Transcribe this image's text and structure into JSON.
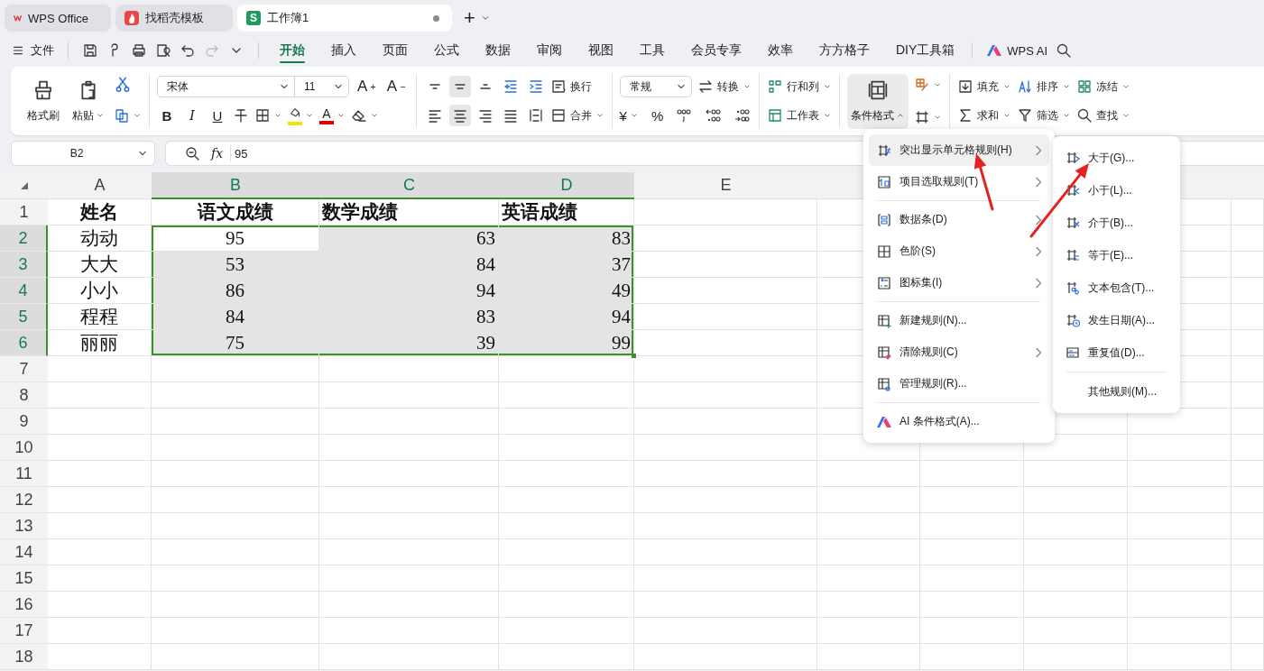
{
  "tabs": [
    {
      "label": "WPS Office",
      "kind": "wps",
      "selected": false,
      "modified": false
    },
    {
      "label": "找稻壳模板",
      "kind": "docer",
      "selected": false,
      "modified": false
    },
    {
      "label": "工作簿1",
      "kind": "sheet",
      "logo": "S",
      "selected": true,
      "modified": true
    }
  ],
  "new_tab": "+",
  "file_menu": "文件",
  "ribbon_tabs": [
    {
      "label": "开始",
      "selected": true
    },
    {
      "label": "插入",
      "selected": false
    },
    {
      "label": "页面",
      "selected": false
    },
    {
      "label": "公式",
      "selected": false
    },
    {
      "label": "数据",
      "selected": false
    },
    {
      "label": "审阅",
      "selected": false
    },
    {
      "label": "视图",
      "selected": false
    },
    {
      "label": "工具",
      "selected": false
    },
    {
      "label": "会员专享",
      "selected": false
    },
    {
      "label": "效率",
      "selected": false
    },
    {
      "label": "方方格子",
      "selected": false
    },
    {
      "label": "DIY工具箱",
      "selected": false
    }
  ],
  "ai_label": "WPS AI",
  "ribbon": {
    "format_painter": "格式刷",
    "paste": "粘贴",
    "font": "宋体",
    "font_size": "11",
    "size_buttons": [
      {
        "letter": "A",
        "sign": "+"
      },
      {
        "letter": "A",
        "sign": "−"
      }
    ],
    "style_buttons": [
      "B",
      "I",
      "U"
    ],
    "font_color_letter": "A",
    "align_buttons": [
      {
        "kind": "top",
        "selected": false
      },
      {
        "kind": "middle",
        "selected": true
      },
      {
        "kind": "bottom",
        "selected": false
      },
      {
        "kind": "outdent",
        "selected": false
      },
      {
        "kind": "indent",
        "selected": false
      },
      {
        "kind": "left",
        "selected": false
      },
      {
        "kind": "center",
        "selected": true
      },
      {
        "kind": "right",
        "selected": false
      },
      {
        "kind": "justify",
        "selected": false
      },
      {
        "kind": "distributed",
        "selected": false
      }
    ],
    "wrap": "换行",
    "merge": "合并",
    "number_format": "常规",
    "convert": "转换",
    "currency": "¥",
    "percent": "%",
    "rows_cols": "行和列",
    "worksheet": "工作表",
    "conditional_format": {
      "label": "条件格式",
      "expanded": true
    },
    "fill": "填充",
    "sort": "排序",
    "freeze": "冻结",
    "sum": "求和",
    "filter": "筛选",
    "find": "查找"
  },
  "name_box": "B2",
  "fx": "fx",
  "formula": "95",
  "columns": [
    {
      "label": "A",
      "selected": false
    },
    {
      "label": "B",
      "selected": true
    },
    {
      "label": "C",
      "selected": true
    },
    {
      "label": "D",
      "selected": true
    },
    {
      "label": "E",
      "selected": false
    }
  ],
  "rows": [
    {
      "label": "1",
      "selected": false,
      "cells": [
        {
          "text": "姓名",
          "selected": false
        },
        {
          "text": "语文成绩",
          "selected": false
        },
        {
          "text": "数学成绩",
          "selected": false
        },
        {
          "text": "英语成绩",
          "selected": false
        }
      ]
    },
    {
      "label": "2",
      "selected": true,
      "cells": [
        {
          "text": "动动",
          "selected": false
        },
        {
          "text": "95",
          "selected": true
        },
        {
          "text": "63",
          "selected": true
        },
        {
          "text": "83",
          "selected": true
        }
      ]
    },
    {
      "label": "3",
      "selected": true,
      "cells": [
        {
          "text": "大大",
          "selected": false
        },
        {
          "text": "53",
          "selected": true
        },
        {
          "text": "84",
          "selected": true
        },
        {
          "text": "37",
          "selected": true
        }
      ]
    },
    {
      "label": "4",
      "selected": true,
      "cells": [
        {
          "text": "小小",
          "selected": false
        },
        {
          "text": "86",
          "selected": true
        },
        {
          "text": "94",
          "selected": true
        },
        {
          "text": "49",
          "selected": true
        }
      ]
    },
    {
      "label": "5",
      "selected": true,
      "cells": [
        {
          "text": "程程",
          "selected": false
        },
        {
          "text": "84",
          "selected": true
        },
        {
          "text": "83",
          "selected": true
        },
        {
          "text": "94",
          "selected": true
        }
      ]
    },
    {
      "label": "6",
      "selected": true,
      "cells": [
        {
          "text": "丽丽",
          "selected": false
        },
        {
          "text": "75",
          "selected": true
        },
        {
          "text": "39",
          "selected": true
        },
        {
          "text": "99",
          "selected": true
        }
      ]
    },
    {
      "label": "7",
      "selected": false
    },
    {
      "label": "8",
      "selected": false
    },
    {
      "label": "9",
      "selected": false
    },
    {
      "label": "10",
      "selected": false
    },
    {
      "label": "11",
      "selected": false
    },
    {
      "label": "12",
      "selected": false
    },
    {
      "label": "13",
      "selected": false
    },
    {
      "label": "14",
      "selected": false
    },
    {
      "label": "15",
      "selected": false
    },
    {
      "label": "16",
      "selected": false
    },
    {
      "label": "17",
      "selected": false
    },
    {
      "label": "18",
      "selected": false
    }
  ],
  "menu": {
    "sections": [
      {
        "items": [
          {
            "label": "突出显示单元格规则(H)",
            "kind": "highlight",
            "submenu": true,
            "selected": true
          },
          {
            "label": "项目选取规则(T)",
            "kind": "top10",
            "submenu": true,
            "selected": false
          }
        ]
      },
      {
        "items": [
          {
            "label": "数据条(D)",
            "kind": "databar",
            "submenu": true,
            "selected": false
          },
          {
            "label": "色阶(S)",
            "kind": "colorscale",
            "submenu": true,
            "selected": false
          },
          {
            "label": "图标集(I)",
            "kind": "iconset",
            "submenu": true,
            "selected": false
          }
        ]
      },
      {
        "items": [
          {
            "label": "新建规则(N)...",
            "kind": "new",
            "submenu": false,
            "selected": false
          },
          {
            "label": "清除规则(C)",
            "kind": "clear",
            "submenu": true,
            "selected": false
          },
          {
            "label": "管理规则(R)...",
            "kind": "manage",
            "submenu": false,
            "selected": false
          }
        ]
      },
      {
        "items": [
          {
            "label": "AI 条件格式(A)...",
            "kind": "ai",
            "submenu": false,
            "selected": false
          }
        ]
      }
    ]
  },
  "submenu": {
    "sections": [
      {
        "items": [
          {
            "label": "大于(G)...",
            "kind": "greater"
          },
          {
            "label": "小于(L)...",
            "kind": "less"
          },
          {
            "label": "介于(B)...",
            "kind": "between"
          },
          {
            "label": "等于(E)...",
            "kind": "equal"
          },
          {
            "label": "文本包含(T)...",
            "kind": "text"
          },
          {
            "label": "发生日期(A)...",
            "kind": "date"
          },
          {
            "label": "重复值(D)...",
            "kind": "duplicate"
          }
        ]
      },
      {
        "items": [
          {
            "label": "其他规则(M)...",
            "kind": "other"
          }
        ]
      }
    ]
  }
}
